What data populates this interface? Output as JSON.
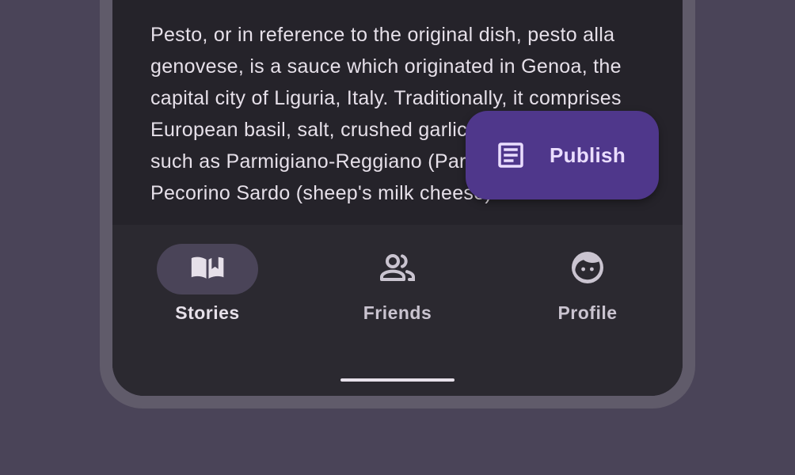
{
  "article": {
    "text": "Pesto, or in reference to the original dish, pesto alla genovese, is a sauce which originated in Genoa, the capital city of Liguria, Italy. Traditionally, it comprises European basil, salt, crushed garlic, and hard cheese such as Parmigiano-Reggiano (Parmesan cheese) or Pecorino Sardo (sheep's milk cheese). These"
  },
  "fab": {
    "label": "Publish",
    "icon": "article-icon"
  },
  "nav": {
    "items": [
      {
        "label": "Stories",
        "icon": "book-icon",
        "active": true
      },
      {
        "label": "Friends",
        "icon": "people-icon",
        "active": false
      },
      {
        "label": "Profile",
        "icon": "face-icon",
        "active": false
      }
    ]
  },
  "colors": {
    "background": "#4a4458",
    "screen": "#211f26",
    "nav_bar": "#2b2930",
    "fab": "#4f378b",
    "fab_content": "#eaddff",
    "active_indicator": "#4a4458",
    "text": "#e6e0e9"
  }
}
